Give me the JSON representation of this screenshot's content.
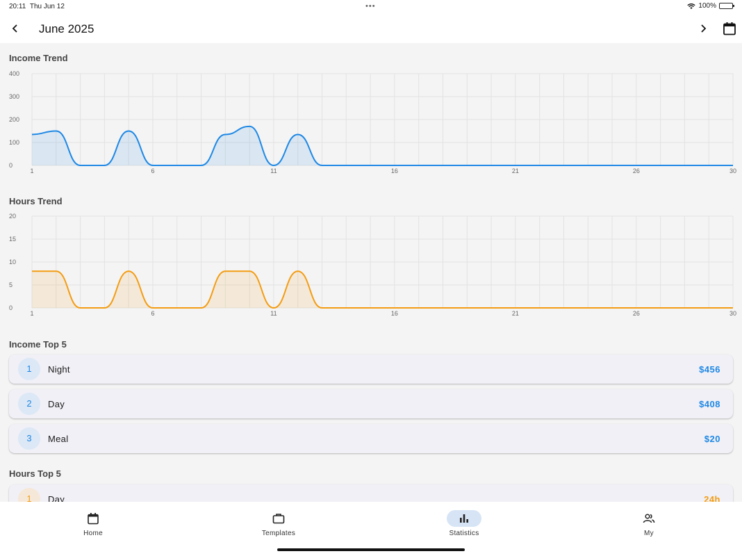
{
  "status": {
    "time": "20:11",
    "date": "Thu Jun 12",
    "battery": "100%"
  },
  "header": {
    "title": "June 2025"
  },
  "income_trend": {
    "title": "Income Trend"
  },
  "hours_trend": {
    "title": "Hours Trend"
  },
  "chart_data": [
    {
      "type": "area",
      "title": "Income Trend",
      "x": [
        1,
        2,
        3,
        4,
        5,
        6,
        7,
        8,
        9,
        10,
        11,
        12,
        13,
        14,
        15,
        16,
        17,
        18,
        19,
        20,
        21,
        22,
        23,
        24,
        25,
        26,
        27,
        28,
        29,
        30
      ],
      "series": [
        {
          "values": [
            135,
            150,
            0,
            0,
            150,
            0,
            0,
            0,
            135,
            170,
            0,
            135,
            0,
            0,
            0,
            0,
            0,
            0,
            0,
            0,
            0,
            0,
            0,
            0,
            0,
            0,
            0,
            0,
            0,
            0
          ]
        }
      ],
      "xticks": [
        "1",
        "6",
        "11",
        "16",
        "21",
        "26",
        "30"
      ],
      "yticks": [
        "0",
        "100",
        "200",
        "300",
        "400"
      ],
      "ylim": [
        0,
        400
      ],
      "color": "#1e88e5",
      "grid": true
    },
    {
      "type": "area",
      "title": "Hours Trend",
      "x": [
        1,
        2,
        3,
        4,
        5,
        6,
        7,
        8,
        9,
        10,
        11,
        12,
        13,
        14,
        15,
        16,
        17,
        18,
        19,
        20,
        21,
        22,
        23,
        24,
        25,
        26,
        27,
        28,
        29,
        30
      ],
      "series": [
        {
          "values": [
            8,
            8,
            0,
            0,
            8,
            0,
            0,
            0,
            8,
            8,
            0,
            8,
            0,
            0,
            0,
            0,
            0,
            0,
            0,
            0,
            0,
            0,
            0,
            0,
            0,
            0,
            0,
            0,
            0,
            0
          ]
        }
      ],
      "xticks": [
        "1",
        "6",
        "11",
        "16",
        "21",
        "26",
        "30"
      ],
      "yticks": [
        "0",
        "5",
        "10",
        "15",
        "20"
      ],
      "ylim": [
        0,
        20
      ],
      "color": "#f39c12",
      "grid": true
    }
  ],
  "income_top": {
    "title": "Income Top 5",
    "items": [
      {
        "rank": "1",
        "name": "Night",
        "value": "$456"
      },
      {
        "rank": "2",
        "name": "Day",
        "value": "$408"
      },
      {
        "rank": "3",
        "name": "Meal",
        "value": "$20"
      }
    ]
  },
  "hours_top": {
    "title": "Hours Top 5",
    "items": [
      {
        "rank": "1",
        "name": "Day",
        "value": "24h"
      }
    ]
  },
  "nav": {
    "items": [
      {
        "label": "Home",
        "icon": "calendar-icon"
      },
      {
        "label": "Templates",
        "icon": "briefcase-icon"
      },
      {
        "label": "Statistics",
        "icon": "bar-chart-icon",
        "active": true
      },
      {
        "label": "My",
        "icon": "people-icon"
      }
    ]
  },
  "colors": {
    "income": "#1e88e5",
    "hours": "#f39c12",
    "active_nav": "#d6e4f5"
  }
}
